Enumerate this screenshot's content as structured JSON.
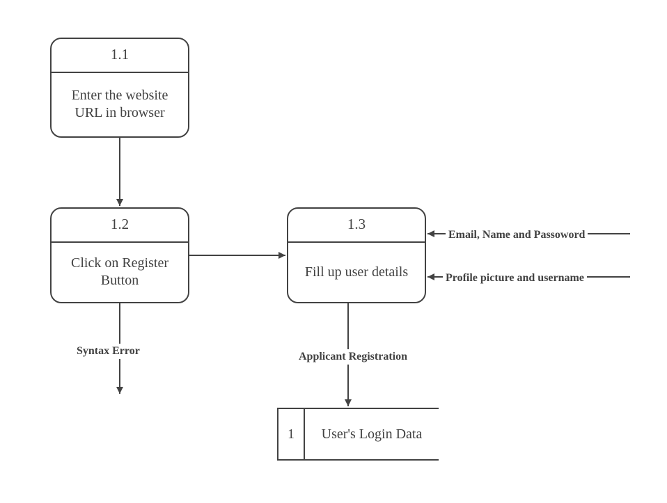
{
  "nodes": {
    "n1": {
      "id": "1.1",
      "text": "Enter the website URL in browser"
    },
    "n2": {
      "id": "1.2",
      "text": "Click on Register Button"
    },
    "n3": {
      "id": "1.3",
      "text": "Fill up user details"
    }
  },
  "datastore": {
    "d1": {
      "id": "1",
      "text": "User's Login Data"
    }
  },
  "edges": {
    "e_syntax": "Syntax Error",
    "e_appreg": "Applicant Registration",
    "e_email": "Email, Name and Passoword",
    "e_profile": "Profile picture and username"
  },
  "colors": {
    "line": "#424242"
  }
}
